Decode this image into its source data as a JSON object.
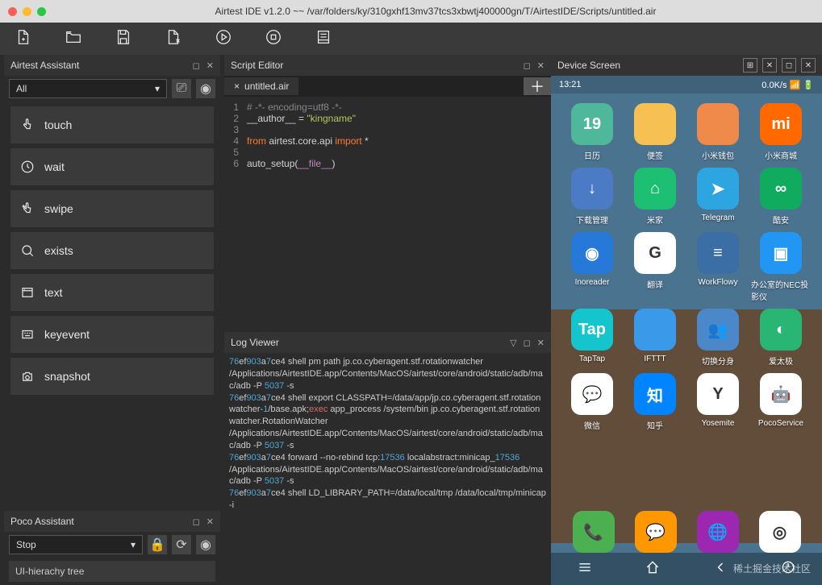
{
  "title": "Airtest IDE v1.2.0 ~~ /var/folders/ky/310gxhf13mv37tcs3xbwtj400000gn/T/AirtestIDE/Scripts/untitled.air",
  "panels": {
    "assistant": "Airtest Assistant",
    "editor": "Script Editor",
    "poco": "Poco Assistant",
    "log": "Log Viewer",
    "device": "Device Screen"
  },
  "assistant_filter": "All",
  "assistant_items": [
    "touch",
    "wait",
    "swipe",
    "exists",
    "text",
    "keyevent",
    "snapshot"
  ],
  "poco_mode": "Stop",
  "poco_tree": "UI-hierachy tree",
  "tab": "untitled.air",
  "code": [
    {
      "n": "1",
      "seg": [
        {
          "c": "c-cmt",
          "t": "# -*- encoding=utf8 -*-"
        }
      ]
    },
    {
      "n": "2",
      "seg": [
        {
          "c": "c-var",
          "t": "__author__ = "
        },
        {
          "c": "c-str",
          "t": "\"kingname\""
        }
      ]
    },
    {
      "n": "3",
      "seg": []
    },
    {
      "n": "4",
      "seg": [
        {
          "c": "c-kw",
          "t": "from"
        },
        {
          "c": "c-var",
          "t": " airtest.core.api "
        },
        {
          "c": "c-kw",
          "t": "import"
        },
        {
          "c": "c-var",
          "t": " *"
        }
      ]
    },
    {
      "n": "5",
      "seg": []
    },
    {
      "n": "6",
      "seg": [
        {
          "c": "c-var",
          "t": "auto_setup("
        },
        {
          "c": "c-fn",
          "t": "__file__"
        },
        {
          "c": "c-var",
          "t": ")"
        }
      ]
    }
  ],
  "log_lines": [
    [
      {
        "c": "l-b",
        "t": "76"
      },
      {
        "c": "",
        "t": "ef"
      },
      {
        "c": "l-b",
        "t": "903"
      },
      {
        "c": "",
        "t": "a"
      },
      {
        "c": "l-b",
        "t": "7"
      },
      {
        "c": "",
        "t": "ce4 shell pm path jp.co.cyberagent.stf.rotationwatcher"
      }
    ],
    [
      {
        "c": "",
        "t": "/Applications/AirtestIDE.app/Contents/MacOS/airtest/core/android/static/adb/mac/adb -P "
      },
      {
        "c": "l-b",
        "t": "5037"
      },
      {
        "c": "",
        "t": " -s"
      }
    ],
    [
      {
        "c": "l-b",
        "t": "76"
      },
      {
        "c": "",
        "t": "ef"
      },
      {
        "c": "l-b",
        "t": "903"
      },
      {
        "c": "",
        "t": "a"
      },
      {
        "c": "l-b",
        "t": "7"
      },
      {
        "c": "",
        "t": "ce4 shell export CLASSPATH=/data/app/jp.co.cyberagent.stf.rotationwatcher-"
      },
      {
        "c": "l-b",
        "t": "1"
      },
      {
        "c": "",
        "t": "/base.apk;"
      },
      {
        "c": "l-r",
        "t": "exec"
      },
      {
        "c": "",
        "t": " app_process /system/bin jp.co.cyberagent.stf.rotationwatcher.RotationWatcher"
      }
    ],
    [
      {
        "c": "",
        "t": "/Applications/AirtestIDE.app/Contents/MacOS/airtest/core/android/static/adb/mac/adb -P "
      },
      {
        "c": "l-b",
        "t": "5037"
      },
      {
        "c": "",
        "t": " -s"
      }
    ],
    [
      {
        "c": "l-b",
        "t": "76"
      },
      {
        "c": "",
        "t": "ef"
      },
      {
        "c": "l-b",
        "t": "903"
      },
      {
        "c": "",
        "t": "a"
      },
      {
        "c": "l-b",
        "t": "7"
      },
      {
        "c": "",
        "t": "ce4 forward --no-rebind tcp:"
      },
      {
        "c": "l-b",
        "t": "17536"
      },
      {
        "c": "",
        "t": " localabstract:minicap_"
      },
      {
        "c": "l-b",
        "t": "17536"
      }
    ],
    [
      {
        "c": "",
        "t": "/Applications/AirtestIDE.app/Contents/MacOS/airtest/core/android/static/adb/mac/adb -P "
      },
      {
        "c": "l-b",
        "t": "5037"
      },
      {
        "c": "",
        "t": " -s"
      }
    ],
    [
      {
        "c": "l-b",
        "t": "76"
      },
      {
        "c": "",
        "t": "ef"
      },
      {
        "c": "l-b",
        "t": "903"
      },
      {
        "c": "",
        "t": "a"
      },
      {
        "c": "l-b",
        "t": "7"
      },
      {
        "c": "",
        "t": "ce4 shell LD_LIBRARY_PATH=/data/local/tmp /data/local/tmp/minicap -i"
      }
    ]
  ],
  "device": {
    "time": "13:21",
    "speed": "0.0K/s",
    "apps": [
      {
        "label": "日历",
        "bg": "#4fb89a",
        "txt": "19"
      },
      {
        "label": "便签",
        "bg": "#f7c052",
        "txt": ""
      },
      {
        "label": "小米钱包",
        "bg": "#f08a4a",
        "txt": ""
      },
      {
        "label": "小米商城",
        "bg": "#ff6900",
        "txt": "mi"
      },
      {
        "label": "下载管理",
        "bg": "#4a7bc4",
        "txt": "↓"
      },
      {
        "label": "米家",
        "bg": "#1dbf73",
        "txt": "⌂"
      },
      {
        "label": "Telegram",
        "bg": "#2ca5e0",
        "txt": "➤"
      },
      {
        "label": "酷安",
        "bg": "#11ab60",
        "txt": "∞"
      },
      {
        "label": "Inoreader",
        "bg": "#2678d9",
        "txt": "◉"
      },
      {
        "label": "翻译",
        "bg": "#ffffff",
        "txt": "G"
      },
      {
        "label": "WorkFlowy",
        "bg": "#3a6ea5",
        "txt": "≡"
      },
      {
        "label": "办公室的NEC投影仪",
        "bg": "#2196f3",
        "txt": "▣"
      },
      {
        "label": "TapTap",
        "bg": "#15c5ce",
        "txt": "Tap"
      },
      {
        "label": "IFTTT",
        "bg": "#3a99e8",
        "txt": ""
      },
      {
        "label": "切换分身",
        "bg": "#4a88c9",
        "txt": "👥"
      },
      {
        "label": "爱太极",
        "bg": "#29b574",
        "txt": "◐"
      },
      {
        "label": "微信",
        "bg": "#ffffff",
        "txt": "💬"
      },
      {
        "label": "知乎",
        "bg": "#0084ff",
        "txt": "知"
      },
      {
        "label": "Yosemite",
        "bg": "#ffffff",
        "txt": "Y"
      },
      {
        "label": "PocoService",
        "bg": "#ffffff",
        "txt": "🤖"
      }
    ],
    "dock": [
      {
        "bg": "#4caf50",
        "txt": "📞"
      },
      {
        "bg": "#ff9800",
        "txt": "💬"
      },
      {
        "bg": "#9c27b0",
        "txt": "🌐"
      },
      {
        "bg": "#ffffff",
        "txt": "◎"
      }
    ],
    "watermark": "稀土掘金技术社区"
  }
}
